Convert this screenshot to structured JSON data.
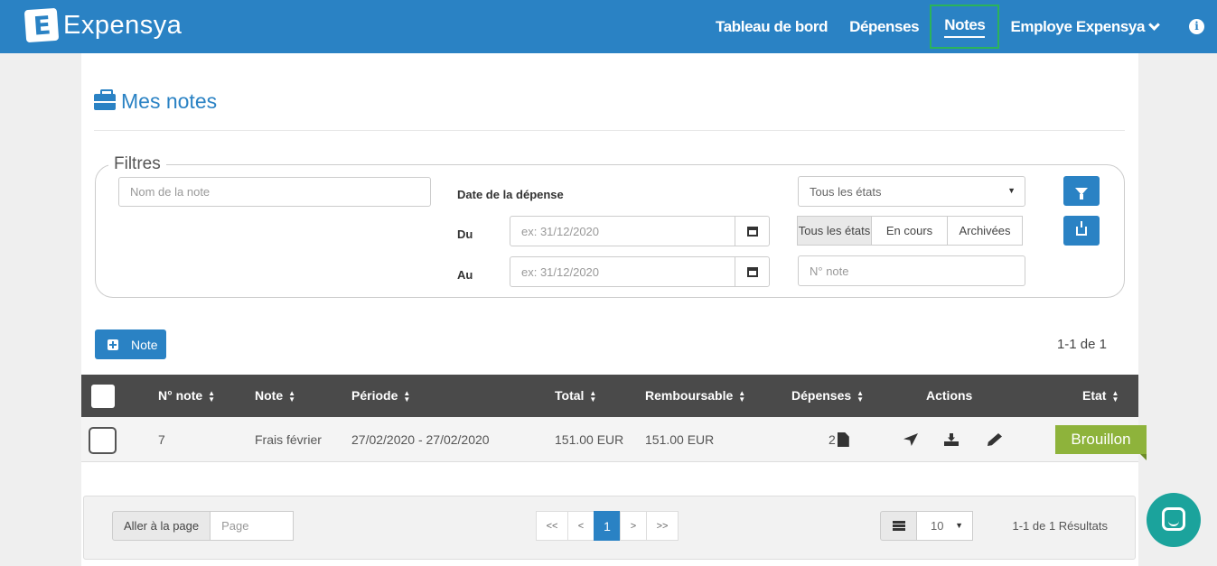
{
  "brand": {
    "name": "Expensya"
  },
  "nav": {
    "items": [
      "Tableau de bord",
      "Dépenses",
      "Notes"
    ],
    "user": "Employe Expensya"
  },
  "page": {
    "title": "Mes notes"
  },
  "filters": {
    "legend": "Filtres",
    "name_placeholder": "Nom de la note",
    "date_label": "Date de la dépense",
    "from_label": "Du",
    "to_label": "Au",
    "date_placeholder": "ex: 31/12/2020",
    "state_select": "Tous les états",
    "state_tabs": [
      "Tous les états",
      "En cours",
      "Archivées"
    ],
    "number_placeholder": "N° note"
  },
  "toolbar": {
    "new_note": "Note",
    "count": "1-1 de 1"
  },
  "table": {
    "headers": [
      "N° note",
      "Note",
      "Période",
      "Total",
      "Remboursable",
      "Dépenses",
      "Actions",
      "Etat"
    ],
    "rows": [
      {
        "number": "7",
        "name": "Frais février",
        "period": "27/02/2020 - 27/02/2020",
        "total": "151.00 EUR",
        "reimbursable": "151.00 EUR",
        "expenses": "2",
        "state": "Brouillon"
      }
    ]
  },
  "pagination": {
    "goto_label": "Aller à la page",
    "goto_placeholder": "Page",
    "first": "<<",
    "prev": "<",
    "current": "1",
    "next": ">",
    "last": ">>",
    "page_size": "10",
    "results": "1-1 de 1 Résultats"
  },
  "colors": {
    "brand": "#2a82c4",
    "draft": "#8eb33b",
    "chat": "#1ba39c",
    "active_nav_outline": "#2bb35a"
  }
}
